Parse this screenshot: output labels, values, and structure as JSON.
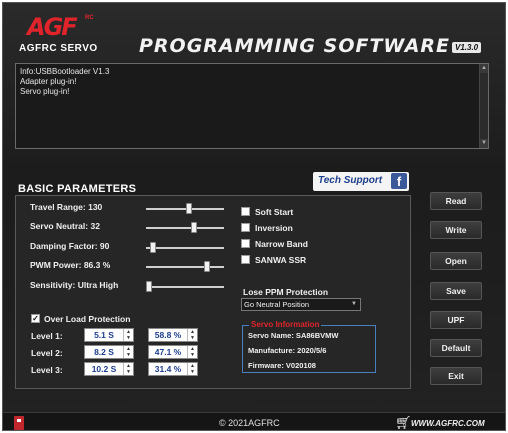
{
  "header": {
    "logo_mark": "AGF",
    "logo_rc": "RC",
    "logo_text": "AGFRC SERVO",
    "title": "PROGRAMMING SOFTWARE",
    "version": "V1.3.0"
  },
  "log": {
    "lines": [
      "Info:USBBootloader V1.3",
      "Adapter plug-in!",
      "Servo plug-in!"
    ]
  },
  "tech_support": {
    "label": "Tech Support",
    "icon": "facebook-icon",
    "icon_glyph": "f"
  },
  "section_title": "BASIC PARAMETERS",
  "params": {
    "travel_range": {
      "label": "Travel Range: 130",
      "level": 0.55
    },
    "servo_neutral": {
      "label": "Servo Neutral: 32",
      "level": 0.63
    },
    "damping_factor": {
      "label": "Damping Factor: 90",
      "level": 0.05
    },
    "pwm_power": {
      "label": "PWM Power: 86.3 %",
      "level": 0.8
    },
    "sensitivity": {
      "label": "Sensitivity: Ultra High",
      "level": 0.0
    }
  },
  "options": {
    "soft_start": {
      "label": "Soft Start",
      "checked": false
    },
    "inversion": {
      "label": "Inversion",
      "checked": false
    },
    "narrow_band": {
      "label": "Narrow Band",
      "checked": false
    },
    "sanwa_ssr": {
      "label": "SANWA SSR",
      "checked": false
    }
  },
  "ppm": {
    "label": "Lose PPM Protection",
    "selected": "Go Neutral Position"
  },
  "servo_info": {
    "title": "Servo Information",
    "name": "Servo Name: SA86BVMW",
    "manufacture": "Manufacture: 2020/5/6",
    "firmware": "Firmware: V020108"
  },
  "overload": {
    "label": "Over Load Protection",
    "checked": true,
    "levels": [
      {
        "label": "Level 1:",
        "time": "5.1 S",
        "percent": "58.8 %"
      },
      {
        "label": "Level 2:",
        "time": "8.2 S",
        "percent": "47.1 %"
      },
      {
        "label": "Level 3:",
        "time": "10.2 S",
        "percent": "31.4 %"
      }
    ]
  },
  "buttons": {
    "read": "Read",
    "write": "Write",
    "open": "Open",
    "save": "Save",
    "upf": "UPF",
    "default": "Default",
    "exit": "Exit"
  },
  "footer": {
    "copyright": "© 2021AGFRC",
    "website": "WWW.AGFRC.COM"
  },
  "colors": {
    "brand_red": "#e0242b",
    "value_blue": "#1d3e8c",
    "info_border": "#4a7fbf"
  }
}
